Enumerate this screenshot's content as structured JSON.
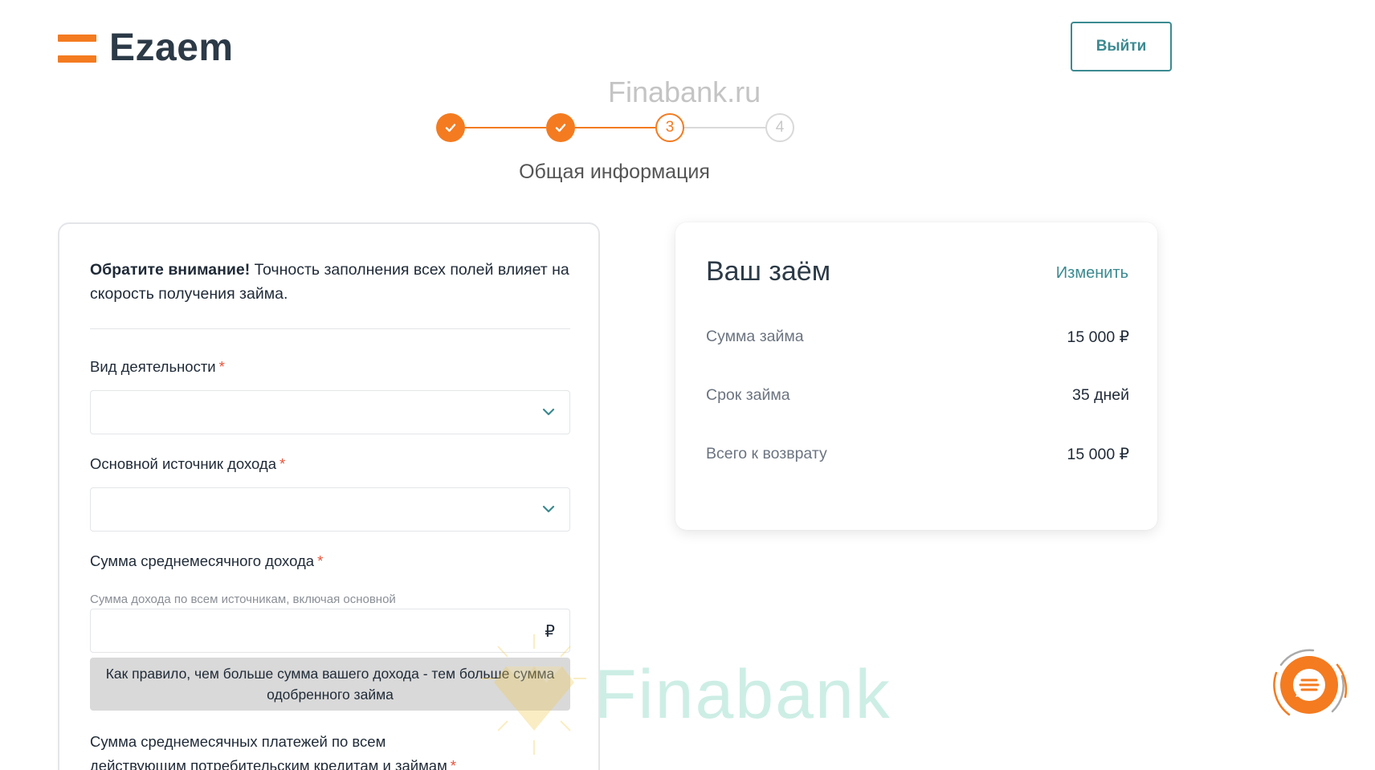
{
  "header": {
    "logo_text": "Ezaem",
    "logout_label": "Выйти"
  },
  "site_watermark": "Finabank.ru",
  "stepper": {
    "steps": [
      {
        "label": "",
        "state": "done"
      },
      {
        "label": "",
        "state": "done"
      },
      {
        "label": "3",
        "state": "active"
      },
      {
        "label": "4",
        "state": "todo"
      }
    ],
    "current_title": "Общая информация"
  },
  "form": {
    "notice_bold": "Обратите внимание!",
    "notice_text": " Точность заполнения всех полей влияет на скорость получения займа.",
    "fields": {
      "activity": {
        "label": "Вид деятельности",
        "value": ""
      },
      "income_source": {
        "label": "Основной источник дохода",
        "value": ""
      },
      "monthly_income": {
        "label": "Сумма среднемесячного дохода",
        "hint": "Сумма дохода по всем источникам, включая основной",
        "value": "",
        "currency": "₽"
      },
      "monthly_payments": {
        "label": "Сумма среднемесячных платежей по всем действующим потребительским кредитам и займам"
      }
    },
    "required_mark": "*",
    "tooltip": "Как правило, чем больше сумма вашего дохода - тем больше сумма одобренного займа"
  },
  "loan": {
    "title": "Ваш заём",
    "edit_label": "Изменить",
    "rows": [
      {
        "key": "Сумма займа",
        "value": "15 000 ₽"
      },
      {
        "key": "Срок займа",
        "value": "35 дней"
      },
      {
        "key": "Всего к возврату",
        "value": "15 000 ₽"
      }
    ]
  },
  "brand_watermark": "Finabank",
  "colors": {
    "accent": "#f47b20",
    "teal": "#3b8a91",
    "border": "#e3e5e8"
  }
}
